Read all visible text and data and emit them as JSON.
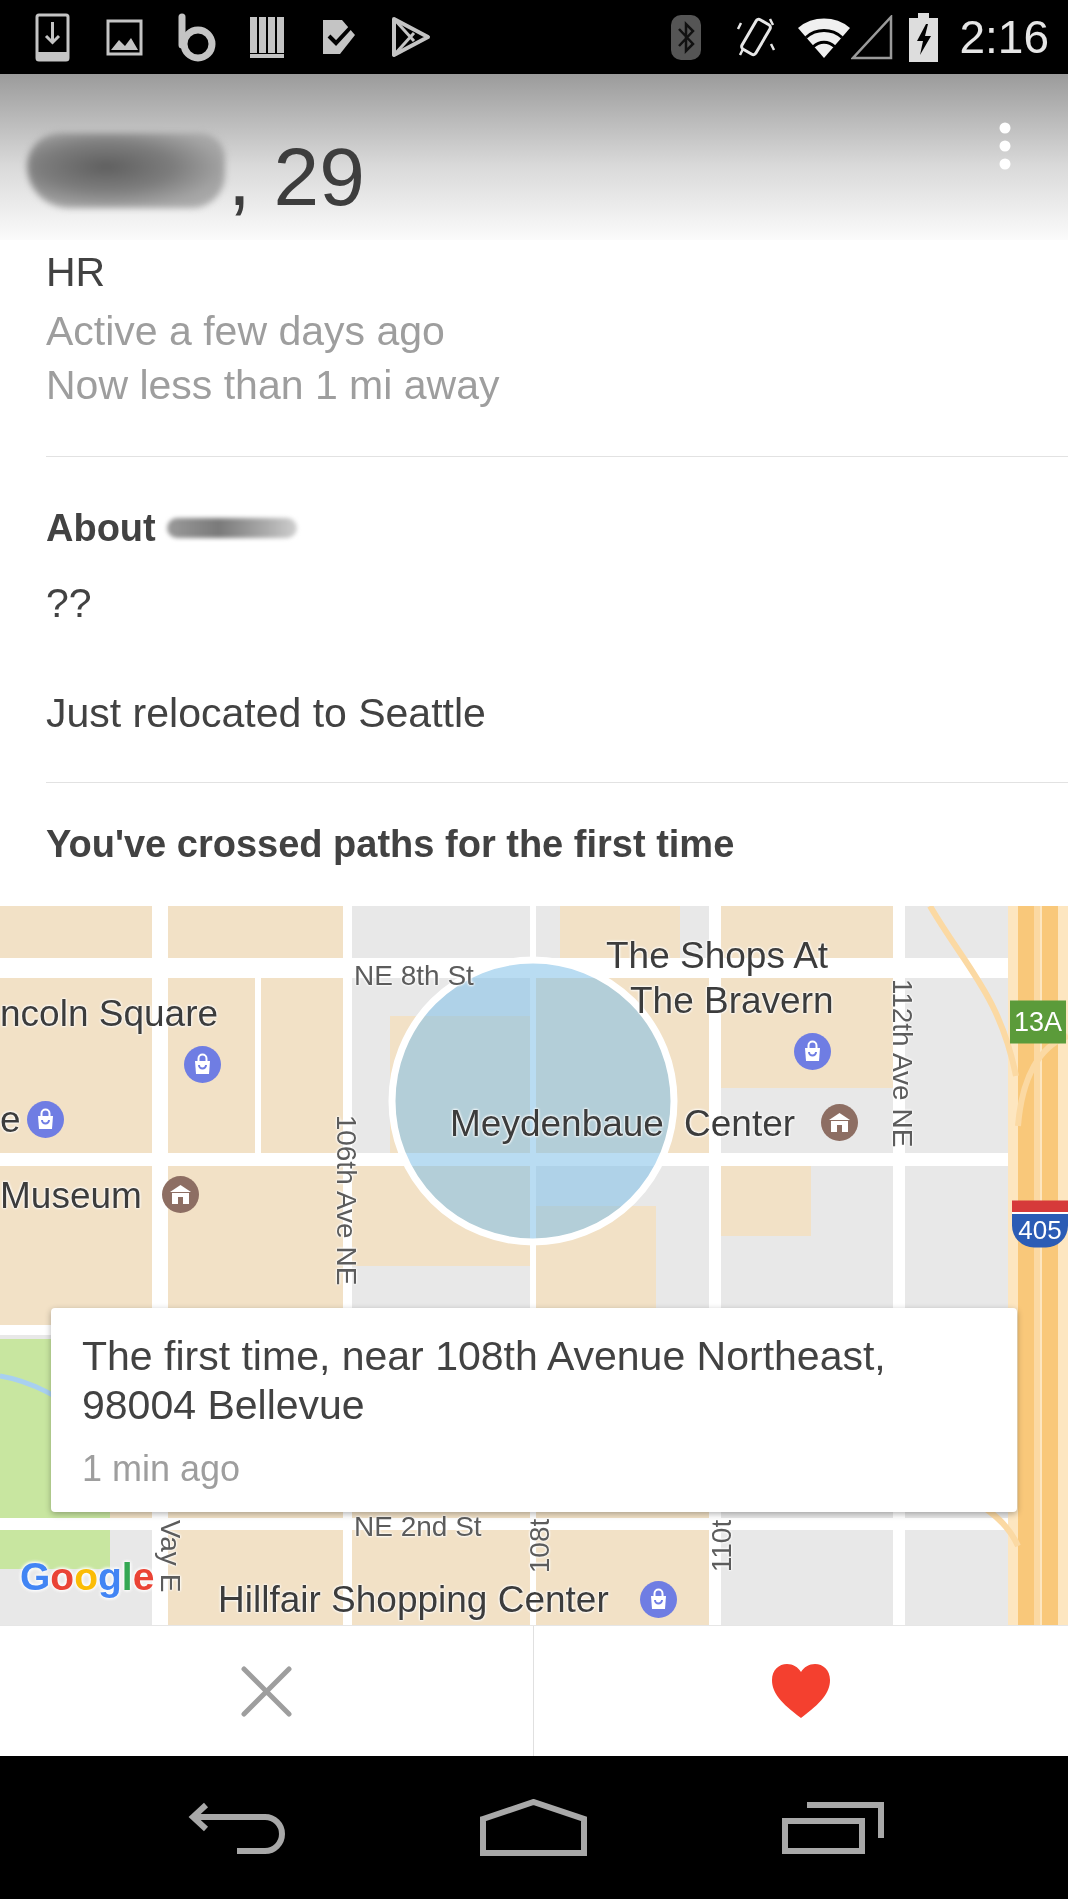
{
  "status_bar": {
    "time": "2:16"
  },
  "header": {
    "name_redacted": true,
    "title": ", 29"
  },
  "profile": {
    "job": "HR",
    "last_active": "Active a few days ago",
    "distance": "Now less than 1 mi away"
  },
  "about": {
    "heading": "About",
    "name_redacted": true,
    "paragraphs": [
      "??",
      "Just relocated to Seattle"
    ]
  },
  "crossed_paths": {
    "heading": "You've crossed paths for the first time",
    "map": {
      "labels": [
        {
          "kind": "street",
          "text": "NE 8th St"
        },
        {
          "kind": "place",
          "text": "The Shops At"
        },
        {
          "kind": "place",
          "text": "The Bravern"
        },
        {
          "kind": "place",
          "text": "ncoln Square"
        },
        {
          "kind": "street",
          "text": "112th Ave NE"
        },
        {
          "kind": "exit",
          "text": "13A"
        },
        {
          "kind": "place",
          "text": "e"
        },
        {
          "kind": "place",
          "text": "Meydenbaue"
        },
        {
          "kind": "place",
          "text": "Center"
        },
        {
          "kind": "place",
          "text": "Museum"
        },
        {
          "kind": "street",
          "text": "106th Ave NE"
        },
        {
          "kind": "shield",
          "text": "405"
        },
        {
          "kind": "street",
          "text": "NE 2nd St"
        },
        {
          "kind": "street",
          "text": "108t"
        },
        {
          "kind": "street",
          "text": "110t"
        },
        {
          "kind": "street",
          "text": "Vay E"
        },
        {
          "kind": "logo",
          "text": "Google"
        },
        {
          "kind": "place",
          "text": "Hillfair Shopping Center"
        }
      ],
      "info_card": {
        "location": "The first time, near 108th Avenue Northeast, 98004 Bellevue",
        "time": "1 min ago"
      }
    }
  }
}
